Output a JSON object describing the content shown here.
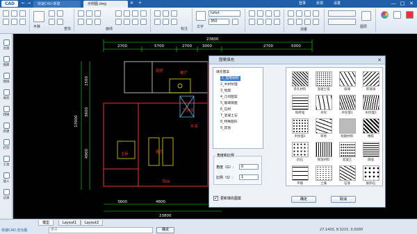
{
  "app": {
    "logo": "CAD",
    "tabs": [
      {
        "label": "快速CAD-新建"
      },
      {
        "label": "示例图.dwg"
      }
    ],
    "title_actions": [
      "登录",
      "反馈",
      "设置"
    ],
    "window_controls": [
      "—",
      "□",
      "✕"
    ]
  },
  "ribbon": {
    "groups": [
      {
        "label": "平移"
      },
      {
        "label": "查找"
      },
      {
        "label": "画线"
      },
      {
        "label": "标注"
      },
      {
        "label": "文字"
      },
      {
        "label": "测量"
      },
      {
        "label": "图层"
      }
    ],
    "font_name": "hztxt",
    "font_size": "350"
  },
  "sidebar": {
    "items": [
      {
        "label": "云盘"
      },
      {
        "label": "图库"
      },
      {
        "label": "图纸"
      },
      {
        "label": "填充"
      },
      {
        "label": "转换"
      },
      {
        "label": "新建"
      },
      {
        "label": "打印"
      },
      {
        "label": "工具"
      },
      {
        "label": "插入"
      },
      {
        "label": "记录"
      }
    ]
  },
  "drawing": {
    "dims_top": [
      "23800",
      "2700",
      "5700",
      "2700",
      "3000",
      "2700",
      "5000"
    ],
    "dims_bottom": [
      "3600",
      "4800",
      "23800"
    ],
    "dims_left": [
      "13900",
      "1500",
      "3600",
      "4900"
    ],
    "room_labels": [
      "厨房",
      "餐厅",
      "客厅",
      "主卧",
      "阳台",
      "卫生间",
      "玄关"
    ]
  },
  "dialog": {
    "title": "图案填充",
    "close": "✕",
    "tree": [
      {
        "label": "填充图案",
        "selected": false
      },
      {
        "label": "1_常用材料",
        "selected": true
      },
      {
        "label": "2_木材纹理",
        "selected": false
      },
      {
        "label": "3_地面",
        "selected": false
      },
      {
        "label": "4_几何图案",
        "selected": false
      },
      {
        "label": "5_玻璃镜面",
        "selected": false
      },
      {
        "label": "6_石材",
        "selected": false
      },
      {
        "label": "7_混凝土石",
        "selected": false
      },
      {
        "label": "8_特殊图形",
        "selected": false
      },
      {
        "label": "9_其他",
        "selected": false
      }
    ],
    "angle_section": "角度和比例",
    "angle_label": "角度（G）:",
    "angle_value": "0",
    "scale_label": "比例（S）:",
    "scale_value": "1",
    "checkbox_label": "更新填充图案",
    "patterns": [
      {
        "label": "多孔材料"
      },
      {
        "label": "混凝土墙"
      },
      {
        "label": "玻璃"
      },
      {
        "label": "新玻璃"
      },
      {
        "label": "新砖墙"
      },
      {
        "label": "木纹"
      },
      {
        "label": "木纹理1"
      },
      {
        "label": "木纹理2"
      },
      {
        "label": "木纹理3"
      },
      {
        "label": "草地"
      },
      {
        "label": "松散材料"
      },
      {
        "label": "橡胶"
      },
      {
        "label": "砂石"
      },
      {
        "label": "保温材料"
      },
      {
        "label": "混凝土"
      },
      {
        "label": "隔墙"
      },
      {
        "label": "平铺"
      },
      {
        "label": "土壤"
      },
      {
        "label": "石墙"
      },
      {
        "label": "鹅卵石"
      }
    ],
    "ok_button": "确定",
    "cancel_button": "取消"
  },
  "layout_tabs": [
    {
      "label": "模型"
    },
    {
      "label": "Layout1"
    },
    {
      "label": "Layout2"
    }
  ],
  "statusbar": {
    "hint": "快速CAD:全功能",
    "command_placeholder": "命令",
    "button": "确定",
    "coordinates": "27.1420, 8.3215, 0.0000"
  }
}
